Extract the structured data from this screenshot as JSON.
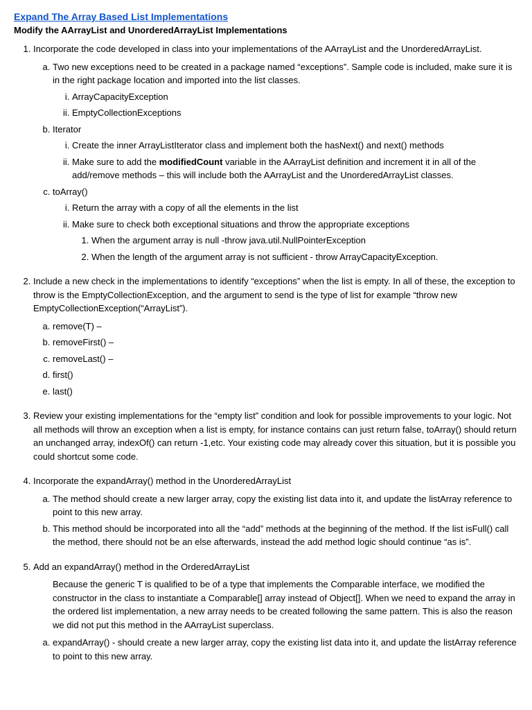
{
  "page": {
    "title": "Expand The Array Based List Implementations",
    "subtitle": "Modify the AArrayList and UnorderedArrayList Implementations",
    "sections": [
      {
        "id": 1,
        "text": "Incorporate the code developed in class into your implementations of the AArrayList and the UnorderedArrayList.",
        "subsections": [
          {
            "label": "a",
            "text": "Two new exceptions need to be created in a package named “exceptions”.  Sample code is included, make sure it is in the right package location and imported into the list classes.",
            "items": [
              "ArrayCapacityException",
              "EmptyCollectionExceptions"
            ]
          },
          {
            "label": "b",
            "text": "Iterator",
            "items": [
              {
                "text": "Create the inner ArrayListIterator class and implement both the hasNext() and next() methods"
              },
              {
                "text_parts": [
                  "Make sure to add the ",
                  "modifiedCount",
                  " variable in the AArrayList definition and increment it in all of the add/remove methods – this will include both the AArrayList and the UnorderedArrayList classes."
                ]
              }
            ]
          },
          {
            "label": "c",
            "text": "toArray()",
            "items": [
              {
                "text": "Return the array with a copy of all the elements in the list"
              },
              {
                "text": "Make sure to check both exceptional situations and throw the appropriate exceptions",
                "subitems": [
                  "When the argument array is null -throw java.util.NullPointerException",
                  "When the length of the argument array is not sufficient  - throw ArrayCapacityException."
                ]
              }
            ]
          }
        ]
      },
      {
        "id": 2,
        "text": "Include a new check in the implementations to identify “exceptions” when the list is empty.  In all of these, the exception to throw is the EmptyCollectionException, and the argument to send is the type of list for example “throw new EmptyCollectionException(“ArrayList”).",
        "subitems": [
          "remove(T) –",
          "removeFirst() –",
          "removeLast() –",
          "first()",
          "last()"
        ]
      },
      {
        "id": 3,
        "text": "Review your existing implementations for the “empty list” condition and look for possible improvements to your logic.  Not all methods will throw an exception when a list is empty, for instance contains can just return false, toArray() should return an unchanged array, indexOf() can return -1,etc.  Your existing code may already cover this situation, but it is possible you could shortcut some code."
      },
      {
        "id": 4,
        "text": "Incorporate the expandArray() method in the UnorderedArrayList",
        "subsections": [
          {
            "label": "a",
            "text": "The method should create a new larger array, copy the existing list data into it, and update the listArray reference to point to this new array."
          },
          {
            "label": "b",
            "text": "This method should be incorporated into all the “add” methods at the beginning of the method.  If the list isFull() call the method, there should not be an else afterwards, instead the add method logic should continue “as is”."
          }
        ]
      },
      {
        "id": 5,
        "text": "Add an expandArray() method in the OrderedArrayList",
        "intro": "Because the generic T is qualified to be of a type that implements the Comparable interface, we modified the constructor in the class to instantiate a Comparable[] array instead of Object[].  When we need to expand the array in the ordered list implementation, a new array needs to be created following the same pattern.  This is also the reason we did not put this method in the AArrayList superclass.",
        "subsections": [
          {
            "label": "a",
            "text": "expandArray() - should create a new larger array, copy the existing list data into it, and update the listArray reference to point to this new array."
          }
        ]
      }
    ]
  }
}
